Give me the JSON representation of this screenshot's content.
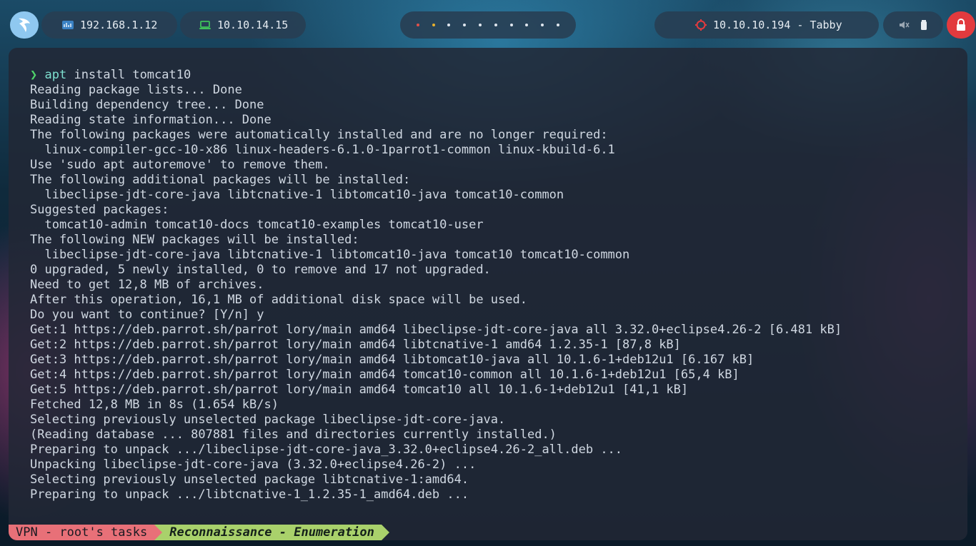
{
  "topbar": {
    "vpn_ip": "192.168.1.12",
    "tun_ip": "10.10.14.15",
    "target": "10.10.10.194 - Tabby",
    "workspace_dots": 10,
    "accent_red": "#e23a3e",
    "accent_blue": "#8fc8f0"
  },
  "terminal": {
    "prompt_symbol": "❯",
    "command": "apt",
    "command_args": " install tomcat10",
    "lines": [
      "Reading package lists... Done",
      "Building dependency tree... Done",
      "Reading state information... Done",
      "The following packages were automatically installed and are no longer required:",
      "  linux-compiler-gcc-10-x86 linux-headers-6.1.0-1parrot1-common linux-kbuild-6.1",
      "Use 'sudo apt autoremove' to remove them.",
      "The following additional packages will be installed:",
      "  libeclipse-jdt-core-java libtcnative-1 libtomcat10-java tomcat10-common",
      "Suggested packages:",
      "  tomcat10-admin tomcat10-docs tomcat10-examples tomcat10-user",
      "The following NEW packages will be installed:",
      "  libeclipse-jdt-core-java libtcnative-1 libtomcat10-java tomcat10 tomcat10-common",
      "0 upgraded, 5 newly installed, 0 to remove and 17 not upgraded.",
      "Need to get 12,8 MB of archives.",
      "After this operation, 16,1 MB of additional disk space will be used.",
      "Do you want to continue? [Y/n] y",
      "Get:1 https://deb.parrot.sh/parrot lory/main amd64 libeclipse-jdt-core-java all 3.32.0+eclipse4.26-2 [6.481 kB]",
      "Get:2 https://deb.parrot.sh/parrot lory/main amd64 libtcnative-1 amd64 1.2.35-1 [87,8 kB]",
      "Get:3 https://deb.parrot.sh/parrot lory/main amd64 libtomcat10-java all 10.1.6-1+deb12u1 [6.167 kB]",
      "Get:4 https://deb.parrot.sh/parrot lory/main amd64 tomcat10-common all 10.1.6-1+deb12u1 [65,4 kB]",
      "Get:5 https://deb.parrot.sh/parrot lory/main amd64 tomcat10 all 10.1.6-1+deb12u1 [41,1 kB]",
      "Fetched 12,8 MB in 8s (1.654 kB/s)",
      "Selecting previously unselected package libeclipse-jdt-core-java.",
      "(Reading database ... 807881 files and directories currently installed.)",
      "Preparing to unpack .../libeclipse-jdt-core-java_3.32.0+eclipse4.26-2_all.deb ...",
      "Unpacking libeclipse-jdt-core-java (3.32.0+eclipse4.26-2) ...",
      "Selecting previously unselected package libtcnative-1:amd64.",
      "Preparing to unpack .../libtcnative-1_1.2.35-1_amd64.deb ..."
    ]
  },
  "statusline": {
    "left": "VPN - root's tasks",
    "right": "Reconnaissance - Enumeration"
  }
}
